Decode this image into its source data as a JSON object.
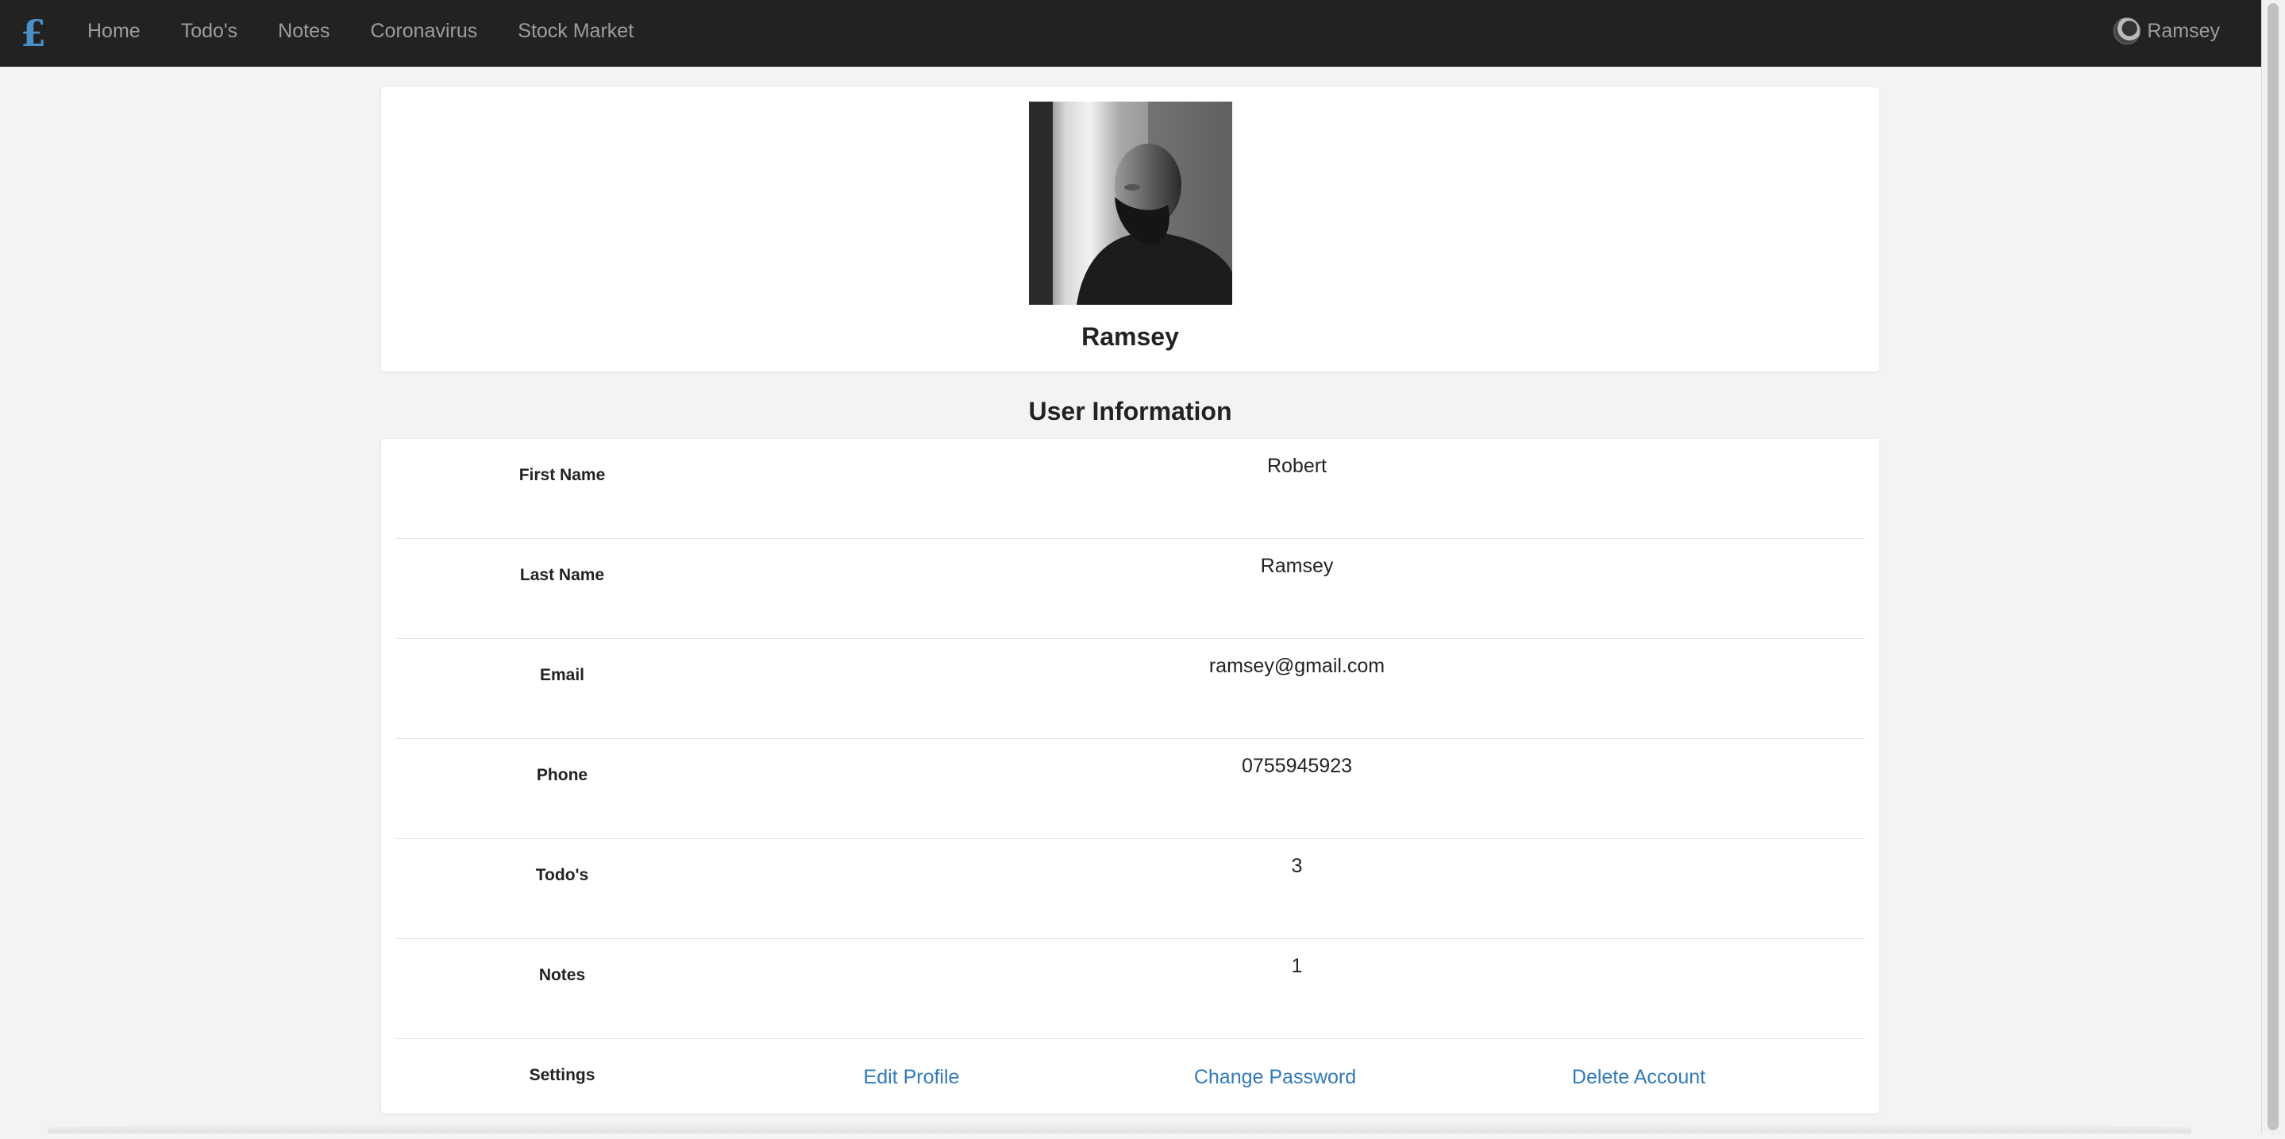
{
  "navbar": {
    "brand": "£",
    "links": [
      "Home",
      "Todo's",
      "Notes",
      "Coronavirus",
      "Stock Market"
    ],
    "user": "Ramsey"
  },
  "profile": {
    "name": "Ramsey"
  },
  "user_info": {
    "title": "User Information",
    "rows": [
      {
        "label": "First Name",
        "value": "Robert"
      },
      {
        "label": "Last Name",
        "value": "Ramsey"
      },
      {
        "label": "Email",
        "value": "ramsey@gmail.com"
      },
      {
        "label": "Phone",
        "value": "0755945923"
      },
      {
        "label": "Todo's",
        "value": "3"
      },
      {
        "label": "Notes",
        "value": "1"
      }
    ],
    "settings": {
      "label": "Settings",
      "edit_profile": "Edit Profile",
      "change_password": "Change Password",
      "delete_account": "Delete Account"
    }
  },
  "colors": {
    "navbar_bg": "#222222",
    "nav_text": "#9d9d9d",
    "brand": "#4a90c8",
    "link": "#337ab7",
    "page_bg": "#f3f3f3"
  }
}
